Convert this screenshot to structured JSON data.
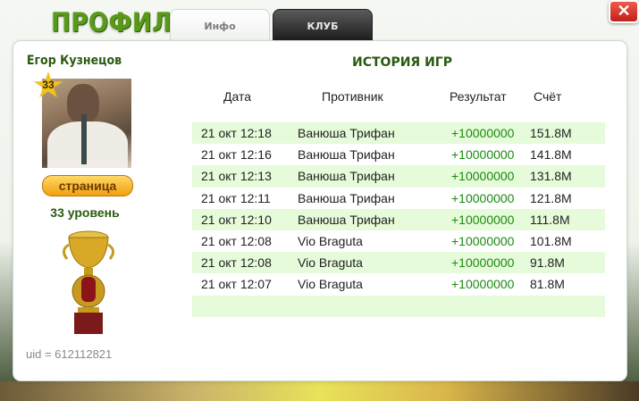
{
  "header": {
    "title": "ПРОФИЛЬ",
    "tabs": [
      {
        "label": "Инфо"
      },
      {
        "label": "КЛУБ"
      }
    ],
    "close_label": "✕"
  },
  "profile": {
    "name": "Егор Кузнецов",
    "level_badge": "33",
    "page_button": "страница",
    "level_text": "33 уровень",
    "uid": "uid = 612112821"
  },
  "history": {
    "title": "ИСТОРИЯ ИГР",
    "columns": [
      "Дата",
      "Противник",
      "Результат",
      "Счёт"
    ],
    "rows": [
      [
        "21 окт 12:18",
        "Ванюша Трифан",
        "+10000000",
        "151.8M"
      ],
      [
        "21 окт 12:16",
        "Ванюша Трифан",
        "+10000000",
        "141.8M"
      ],
      [
        "21 окт 12:13",
        "Ванюша Трифан",
        "+10000000",
        "131.8M"
      ],
      [
        "21 окт 12:11",
        "Ванюша Трифан",
        "+10000000",
        "121.8M"
      ],
      [
        "21 окт 12:10",
        "Ванюша Трифан",
        "+10000000",
        "111.8M"
      ],
      [
        "21 окт 12:08",
        "Vio Braguta",
        "+10000000",
        "101.8M"
      ],
      [
        "21 окт 12:08",
        "Vio Braguta",
        "+10000000",
        "91.8M"
      ],
      [
        "21 окт 12:07",
        "Vio Braguta",
        "+10000000",
        "81.8M"
      ],
      [
        "",
        "",
        "",
        ""
      ]
    ]
  },
  "colors": {
    "accent_green": "#2a5a10",
    "result_green": "#1a8a10",
    "row_alt": "#e6fbd9"
  }
}
